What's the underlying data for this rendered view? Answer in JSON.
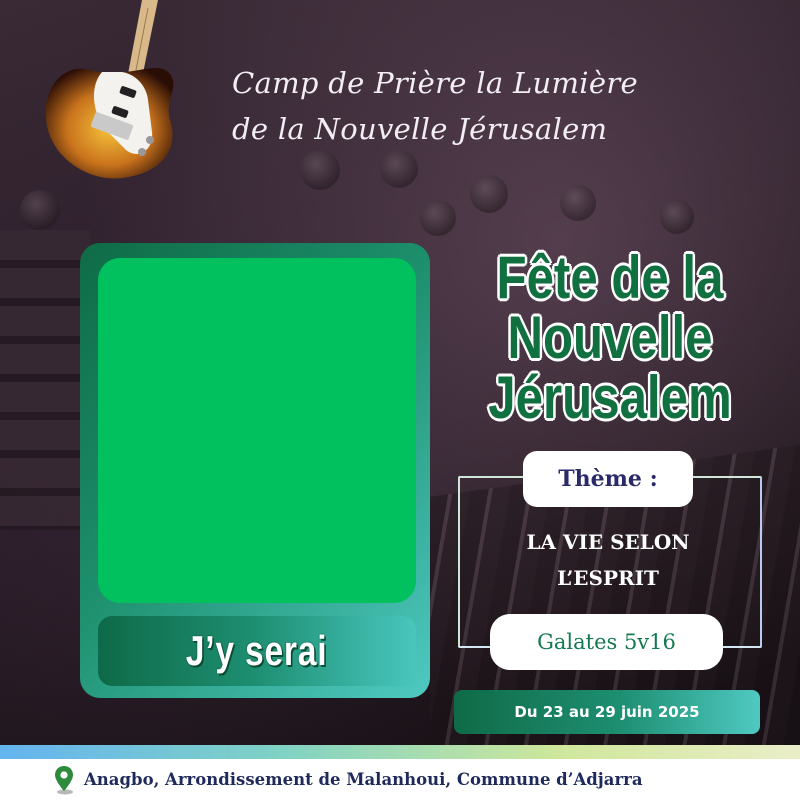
{
  "header": {
    "camp_title_line1": "Camp de Prière la Lumière",
    "camp_title_line2": "de la Nouvelle Jérusalem"
  },
  "photo_frame": {
    "slot_color": "#00c15e",
    "caption": "J’y serai"
  },
  "event": {
    "title_line1": "Fête de la",
    "title_line2": "Nouvelle",
    "title_line3": "Jérusalem",
    "title_color": "#10703f"
  },
  "theme": {
    "label": "Thème :",
    "line1": "LA VIE SELON",
    "line2": "L’ESPRIT",
    "verse": "Galates 5v16"
  },
  "dates": "Du 23 au 29 juin 2025",
  "footer": {
    "location": "Anagbo, Arrondissement de Malanhoui, Commune d’Adjarra",
    "icon": "location-pin-icon"
  },
  "colors": {
    "accent_green": "#0f6b47",
    "accent_teal": "#4fc9c2",
    "navy_text": "#1f2a5c"
  }
}
